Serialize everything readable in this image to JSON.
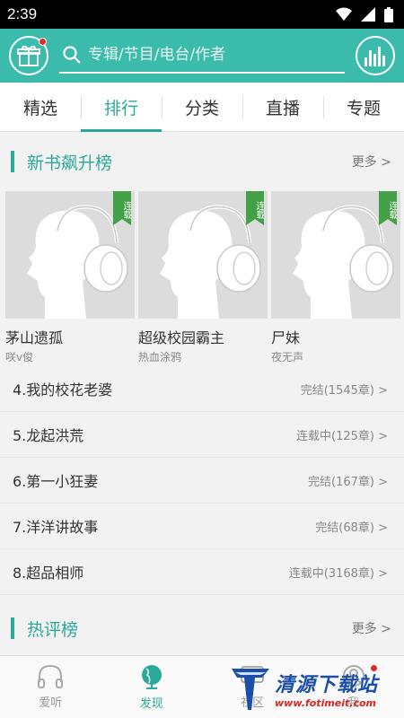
{
  "status_bar": {
    "time": "2:39"
  },
  "search": {
    "placeholder": "专辑/节目/电台/作者"
  },
  "tabs": [
    {
      "label": "精选"
    },
    {
      "label": "排行"
    },
    {
      "label": "分类"
    },
    {
      "label": "直播"
    },
    {
      "label": "专题"
    }
  ],
  "new_books": {
    "title": "新书飙升榜",
    "more": "更多 >",
    "cards": [
      {
        "title": "茅山遗孤",
        "author": "咲v俊",
        "badge": "连载"
      },
      {
        "title": "超级校园霸主",
        "author": "热血涂鸦",
        "badge": "连载"
      },
      {
        "title": "尸妹",
        "author": "夜无声",
        "badge": "连载"
      }
    ],
    "list": [
      {
        "name": "4.我的校花老婆",
        "status": "完结(1545章) >"
      },
      {
        "name": "5.龙起洪荒",
        "status": "连载中(125章) >"
      },
      {
        "name": "6.第一小狂妻",
        "status": "完结(167章) >"
      },
      {
        "name": "7.洋洋讲故事",
        "status": "完结(68章) >"
      },
      {
        "name": "8.超品相师",
        "status": "连载中(3168章) >"
      }
    ]
  },
  "hot_comments": {
    "title": "热评榜",
    "more": "更多 >"
  },
  "bottom_nav": [
    {
      "label": "爱听"
    },
    {
      "label": "发现"
    },
    {
      "label": "社区"
    },
    {
      "label": "我"
    }
  ],
  "watermark": {
    "text": "清源下载站",
    "url": "www.fotimeit.com"
  },
  "colors": {
    "accent": "#3bbbab",
    "accent_dark": "#2aa99a",
    "badge": "#43a047",
    "notification": "#e02b2b"
  }
}
